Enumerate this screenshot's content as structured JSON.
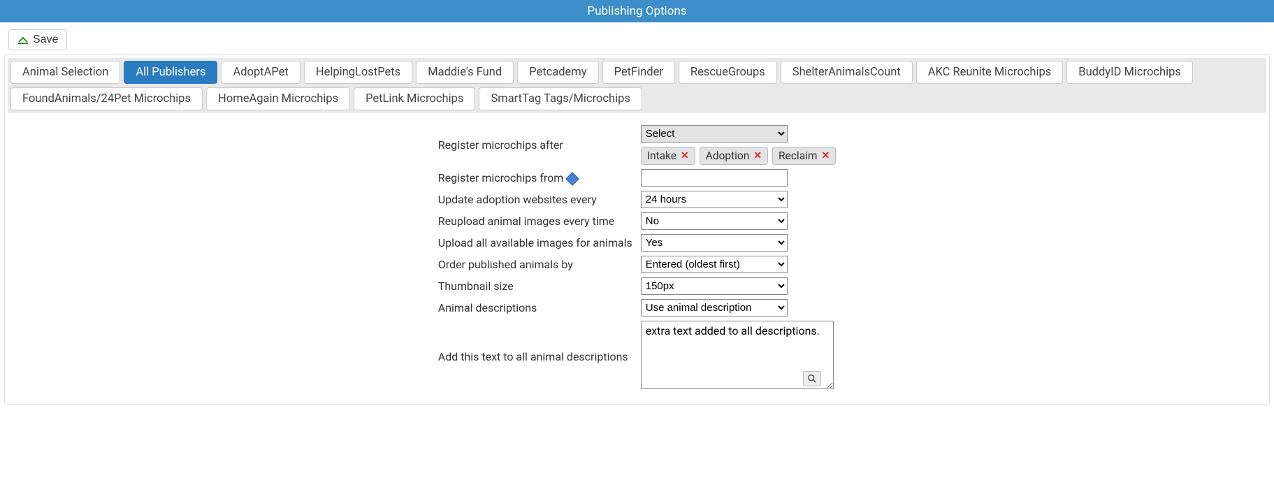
{
  "titlebar": {
    "title": "Publishing Options"
  },
  "toolbar": {
    "save_label": "Save"
  },
  "tabs": {
    "items": [
      "Animal Selection",
      "All Publishers",
      "AdoptAPet",
      "HelpingLostPets",
      "Maddie's Fund",
      "Petcademy",
      "PetFinder",
      "RescueGroups",
      "ShelterAnimalsCount",
      "AKC Reunite Microchips",
      "BuddyID Microchips",
      "FoundAnimals/24Pet Microchips",
      "HomeAgain Microchips",
      "PetLink Microchips",
      "SmartTag Tags/Microchips"
    ],
    "active_index": 1
  },
  "form": {
    "register_after": {
      "label": "Register microchips after",
      "select_placeholder": "Select",
      "chips": [
        "Intake",
        "Adoption",
        "Reclaim"
      ]
    },
    "register_from": {
      "label": "Register microchips from",
      "value": ""
    },
    "update_every": {
      "label": "Update adoption websites every",
      "value": "24 hours"
    },
    "reupload": {
      "label": "Reupload animal images every time",
      "value": "No"
    },
    "upload_all": {
      "label": "Upload all available images for animals",
      "value": "Yes"
    },
    "order_by": {
      "label": "Order published animals by",
      "value": "Entered (oldest first)"
    },
    "thumb_size": {
      "label": "Thumbnail size",
      "value": "150px"
    },
    "descriptions": {
      "label": "Animal descriptions",
      "value": "Use animal description"
    },
    "extra_text": {
      "label": "Add this text to all animal descriptions",
      "value": "extra text added to all descriptions."
    }
  }
}
